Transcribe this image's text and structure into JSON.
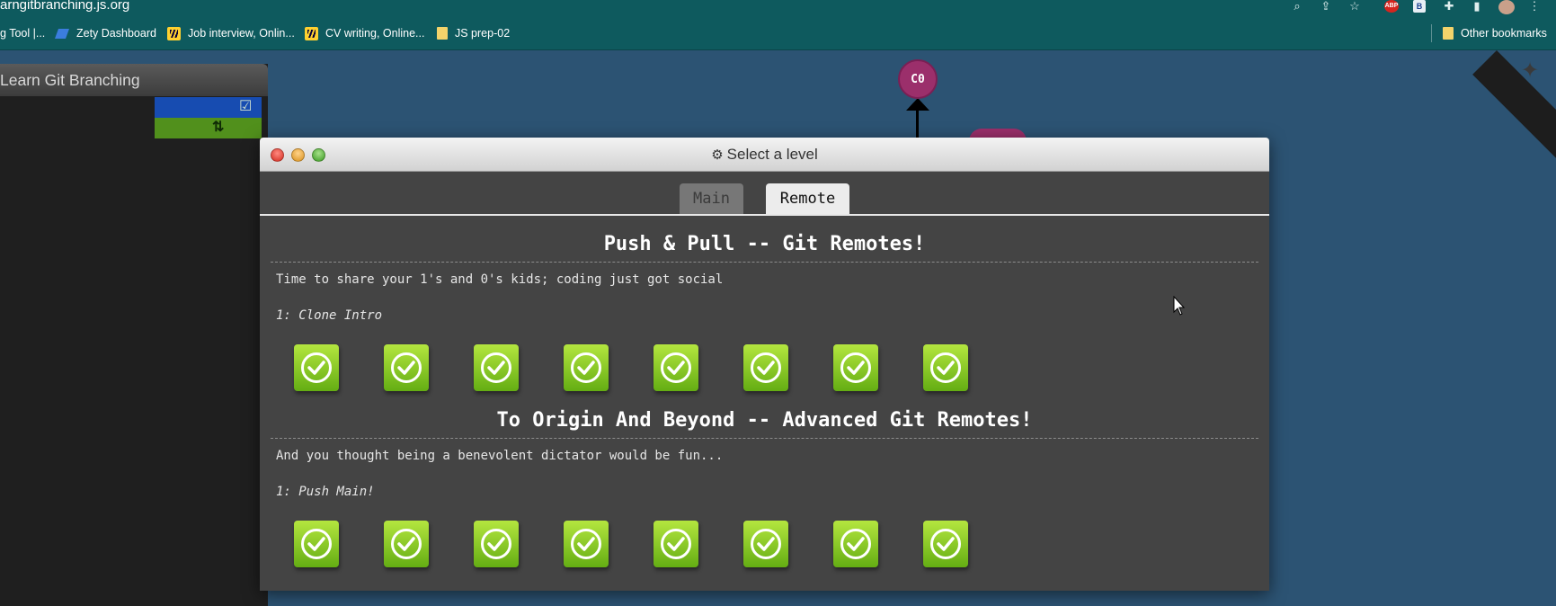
{
  "browser": {
    "url": "arngitbranching.js.org",
    "bookmarks": [
      "g Tool |...",
      "Zety Dashboard",
      "Job interview, Onlin...",
      "CV writing, Online...",
      "JS prep-02"
    ],
    "other_bookmarks": "Other bookmarks",
    "icons": [
      "zoom-icon",
      "share-icon",
      "star-icon",
      "adblock-icon",
      "extension-b-icon",
      "puzzle-icon",
      "sidepanel-icon",
      "profile-avatar",
      "menu-icon"
    ],
    "adblock_label": "ABP",
    "ext_label": "B"
  },
  "app": {
    "left_title": "Learn Git Branching",
    "commit_label": "C0",
    "colors": {
      "background": "#2c5373",
      "commit": "#9b2f6b",
      "level_complete": "#7cc21f"
    }
  },
  "modal": {
    "title": "Select a level",
    "tabs": [
      {
        "label": "Main",
        "active": false
      },
      {
        "label": "Remote",
        "active": true
      }
    ],
    "sequences": [
      {
        "title": "Push & Pull -- Git Remotes!",
        "about": "Time to share your 1's and 0's kids; coding just got social",
        "current_level": "1: Clone Intro",
        "level_count": 8,
        "completed": 8
      },
      {
        "title": "To Origin And Beyond -- Advanced Git Remotes!",
        "about": "And you thought being a benevolent dictator would be fun...",
        "current_level": "1: Push Main!",
        "level_count": 8,
        "completed": 8
      }
    ]
  }
}
